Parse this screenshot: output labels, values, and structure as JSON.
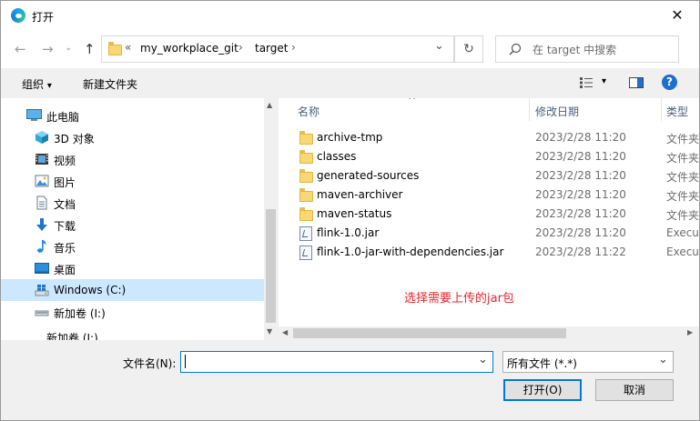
{
  "window": {
    "title": "打开",
    "close_glyph": "✕"
  },
  "nav": {
    "back": "←",
    "forward": "→",
    "up": "↑",
    "refresh": "↻"
  },
  "address": {
    "prefix": "«",
    "crumbs": [
      "my_workplace_git",
      "target"
    ],
    "separator": "›",
    "dropdown": "⌄"
  },
  "search": {
    "placeholder": "在 target 中搜索"
  },
  "toolbar": {
    "organize": "组织",
    "organize_arrow": "▾",
    "new_folder": "新建文件夹",
    "view_arrow": "▾",
    "help": "?"
  },
  "sidebar": {
    "items": [
      {
        "label": "此电脑",
        "icon": "computer-icon"
      },
      {
        "label": "3D 对象",
        "icon": "3d-objects-icon"
      },
      {
        "label": "视频",
        "icon": "video-icon"
      },
      {
        "label": "图片",
        "icon": "picture-icon"
      },
      {
        "label": "文档",
        "icon": "document-icon"
      },
      {
        "label": "下载",
        "icon": "download-icon"
      },
      {
        "label": "音乐",
        "icon": "music-icon"
      },
      {
        "label": "桌面",
        "icon": "desktop-icon"
      },
      {
        "label": "Windows (C:)",
        "icon": "drive-c-icon",
        "selected": true
      },
      {
        "label": "新加卷 (I:)",
        "icon": "drive-i-icon"
      },
      {
        "label": "新加卷 (I:)",
        "icon": "drive-i-icon"
      }
    ]
  },
  "columns": {
    "name": "名称",
    "date": "修改日期",
    "type": "类型",
    "sort_indicator": "^"
  },
  "files": [
    {
      "name": "archive-tmp",
      "date": "2023/2/28 11:20",
      "type": "文件夹",
      "kind": "folder"
    },
    {
      "name": "classes",
      "date": "2023/2/28 11:20",
      "type": "文件夹",
      "kind": "folder"
    },
    {
      "name": "generated-sources",
      "date": "2023/2/28 11:20",
      "type": "文件夹",
      "kind": "folder"
    },
    {
      "name": "maven-archiver",
      "date": "2023/2/28 11:20",
      "type": "文件夹",
      "kind": "folder"
    },
    {
      "name": "maven-status",
      "date": "2023/2/28 11:20",
      "type": "文件夹",
      "kind": "folder"
    },
    {
      "name": "flink-1.0.jar",
      "date": "2023/2/28 11:20",
      "type": "Executable Jar File",
      "kind": "jar"
    },
    {
      "name": "flink-1.0-jar-with-dependencies.jar",
      "date": "2023/2/28 11:22",
      "type": "Executable Jar File",
      "kind": "jar"
    }
  ],
  "annotation": {
    "text": "选择需要上传的jar包",
    "color": "#e8262b"
  },
  "bottom": {
    "filename_label": "文件名(N):",
    "filename_value": "",
    "filetype_value": "所有文件 (*.*)",
    "open_button": "打开(O)",
    "cancel_button": "取消"
  },
  "colors": {
    "selection": "#cce8ff",
    "accent": "#0078d7",
    "help_blue": "#1e6fd0"
  }
}
